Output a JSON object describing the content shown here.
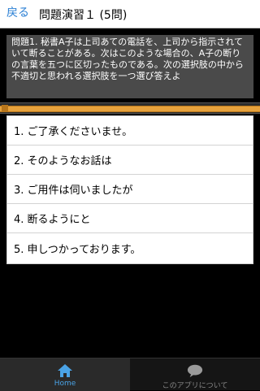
{
  "header": {
    "back_label": "戻る",
    "title": "問題演習１ (5問)"
  },
  "question": {
    "text": "問題1. 秘書A子は上司あての電話を、上司から指示されていて断ることがある。次はこのような場合の、A子の断りの言葉を五つに区切ったものである。次の選択肢の中から不適切と思われる選択肢を一つ選び答えよ"
  },
  "progress": {
    "fraction": 1.0
  },
  "options": [
    {
      "label": "1. ご了承くださいませ。"
    },
    {
      "label": "2. そのようなお話は"
    },
    {
      "label": "3. ご用件は伺いましたが"
    },
    {
      "label": "4. 断るようにと"
    },
    {
      "label": "5. 申しつかっております。"
    }
  ],
  "bottom_nav": {
    "home_label": "Home",
    "about_label": "このアプリについて"
  },
  "colors": {
    "accent": "#2a7fd4",
    "progress": "#e7a23c"
  }
}
